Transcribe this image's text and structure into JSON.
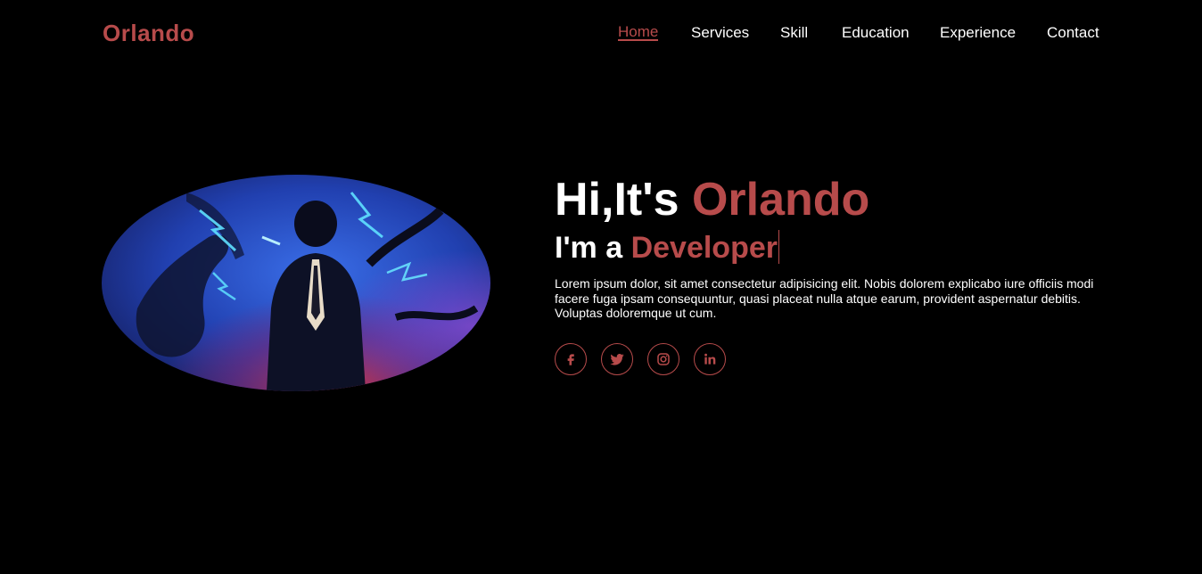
{
  "brand": {
    "logo": "Orlando",
    "accent_color": "#b74b4b"
  },
  "nav": {
    "items": [
      {
        "label": "Home",
        "active": true
      },
      {
        "label": "Services",
        "active": false
      },
      {
        "label": "Skill",
        "active": false
      },
      {
        "label": "Education",
        "active": false
      },
      {
        "label": "Experience",
        "active": false
      },
      {
        "label": "Contact",
        "active": false
      }
    ]
  },
  "hero": {
    "greeting_prefix": "Hi,It's",
    "greeting_name": "Orlando",
    "role_prefix": "I'm a",
    "role_title": "Developer",
    "bio": "Lorem ipsum dolor, sit amet consectetur adipisicing elit. Nobis dolorem explicabo iure officiis modi facere fuga ipsam consequuntur, quasi placeat nulla atque earum, provident aspernatur debitis. Voluptas doloremque ut cum."
  },
  "socials": [
    {
      "icon": "facebook-icon"
    },
    {
      "icon": "twitter-icon"
    },
    {
      "icon": "instagram-icon"
    },
    {
      "icon": "linkedin-icon"
    }
  ]
}
